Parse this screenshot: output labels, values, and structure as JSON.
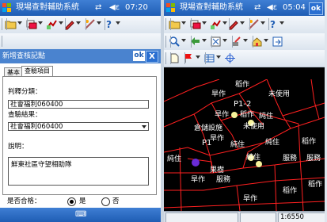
{
  "left_app": {
    "title": "現場查對輔助系統",
    "time": "07:20",
    "dialog_title": "新增查核記點",
    "dialog_ok": "ok",
    "dialog_close": "X",
    "tabs": [
      "基本",
      "查驗項目"
    ],
    "fields": {
      "category_label": "判釋分類：",
      "category_value": "社會福利060400",
      "result_label": "查驗結果：",
      "result_value": "社會福利060400",
      "notes_label": "說明：",
      "notes_value": "鮮東社區守望相助隊",
      "pass_label": "是否合格：",
      "yes_label": "是",
      "no_label": "否"
    }
  },
  "right_app": {
    "title": "現場查對輔助系統",
    "time": "05:04",
    "ok": "ok",
    "scale": "1:6550",
    "map_labels": [
      {
        "text": "稻作"
      },
      {
        "text": "未使用"
      },
      {
        "text": "旱作"
      },
      {
        "text": "P1-2"
      },
      {
        "text": "旱作"
      },
      {
        "text": "稻作"
      },
      {
        "text": "純住"
      },
      {
        "text": "倉儲設施"
      },
      {
        "text": "未使用"
      },
      {
        "text": "稻作"
      },
      {
        "text": "旱作"
      },
      {
        "text": "P1"
      },
      {
        "text": "純住"
      },
      {
        "text": "純住"
      },
      {
        "text": "純住"
      },
      {
        "text": "服務"
      },
      {
        "text": "服務"
      },
      {
        "text": "純住"
      },
      {
        "text": "果樹"
      },
      {
        "text": "服務"
      },
      {
        "text": "旱作"
      },
      {
        "text": "稻作"
      },
      {
        "text": "旱作"
      },
      {
        "text": "稻作"
      }
    ]
  },
  "colors": {
    "titlebar": "#1f5db4",
    "map_bg": "#000000",
    "parcel_line": "#ff2020",
    "point_yellow": "#f6f29a",
    "point_purple": "#6a2bd6"
  }
}
